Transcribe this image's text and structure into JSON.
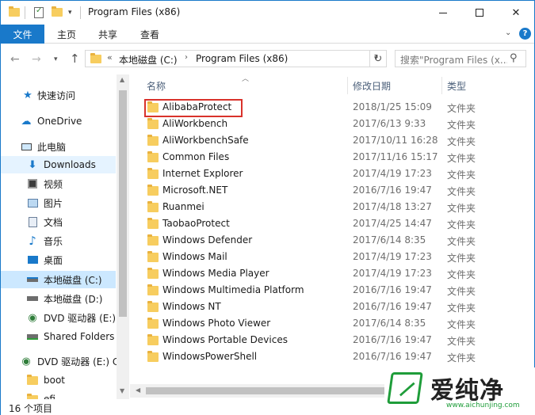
{
  "window": {
    "title": "Program Files (x86)"
  },
  "ribbon": {
    "tabs": [
      "文件",
      "主页",
      "共享",
      "查看"
    ],
    "help": "?"
  },
  "address": {
    "segments": [
      "本地磁盘 (C:)",
      "Program Files (x86)"
    ],
    "overflow": "«",
    "search_placeholder": "搜索\"Program Files (x..."
  },
  "sidebar": {
    "items": [
      {
        "label": "快速访问",
        "icon": "star-icon"
      },
      {
        "label": "OneDrive",
        "icon": "cloud-icon"
      },
      {
        "label": "此电脑",
        "icon": "computer-icon"
      },
      {
        "label": "Downloads",
        "icon": "download-arrow-icon"
      },
      {
        "label": "视频",
        "icon": "video-icon"
      },
      {
        "label": "图片",
        "icon": "picture-icon"
      },
      {
        "label": "文档",
        "icon": "document-icon"
      },
      {
        "label": "音乐",
        "icon": "music-note-icon"
      },
      {
        "label": "桌面",
        "icon": "desktop-icon"
      },
      {
        "label": "本地磁盘 (C:)",
        "icon": "drive-icon"
      },
      {
        "label": "本地磁盘 (D:)",
        "icon": "drive-icon"
      },
      {
        "label": "DVD 驱动器 (E:)",
        "icon": "dvd-icon"
      },
      {
        "label": "Shared Folders",
        "icon": "network-drive-icon"
      },
      {
        "label": "DVD 驱动器 (E:) C",
        "icon": "dvd-icon"
      },
      {
        "label": "boot",
        "icon": "folder-icon"
      },
      {
        "label": "efi",
        "icon": "folder-icon"
      }
    ]
  },
  "columns": {
    "name": "名称",
    "date": "修改日期",
    "type": "类型"
  },
  "files": [
    {
      "name": "AlibabaProtect",
      "date": "2018/1/25 15:09",
      "type": "文件夹"
    },
    {
      "name": "AliWorkbench",
      "date": "2017/6/13 9:33",
      "type": "文件夹"
    },
    {
      "name": "AliWorkbenchSafe",
      "date": "2017/10/11 16:28",
      "type": "文件夹"
    },
    {
      "name": "Common Files",
      "date": "2017/11/16 15:17",
      "type": "文件夹"
    },
    {
      "name": "Internet Explorer",
      "date": "2017/4/19 17:23",
      "type": "文件夹"
    },
    {
      "name": "Microsoft.NET",
      "date": "2016/7/16 19:47",
      "type": "文件夹"
    },
    {
      "name": "Ruanmei",
      "date": "2017/4/18 13:27",
      "type": "文件夹"
    },
    {
      "name": "TaobaoProtect",
      "date": "2017/4/25 14:47",
      "type": "文件夹"
    },
    {
      "name": "Windows Defender",
      "date": "2017/6/14 8:35",
      "type": "文件夹"
    },
    {
      "name": "Windows Mail",
      "date": "2017/4/19 17:23",
      "type": "文件夹"
    },
    {
      "name": "Windows Media Player",
      "date": "2017/4/19 17:23",
      "type": "文件夹"
    },
    {
      "name": "Windows Multimedia Platform",
      "date": "2016/7/16 19:47",
      "type": "文件夹"
    },
    {
      "name": "Windows NT",
      "date": "2016/7/16 19:47",
      "type": "文件夹"
    },
    {
      "name": "Windows Photo Viewer",
      "date": "2017/6/14 8:35",
      "type": "文件夹"
    },
    {
      "name": "Windows Portable Devices",
      "date": "2016/7/16 19:47",
      "type": "文件夹"
    },
    {
      "name": "WindowsPowerShell",
      "date": "2016/7/16 19:47",
      "type": "文件夹"
    }
  ],
  "status": {
    "count": "16 个项目"
  },
  "watermark": {
    "text": "爱纯净",
    "url": "www.aichunjing.com"
  },
  "colors": {
    "accent": "#1979ca",
    "selected": "#cce8ff",
    "folder": "#f7cd5f",
    "highlight_border": "#d9322b"
  }
}
